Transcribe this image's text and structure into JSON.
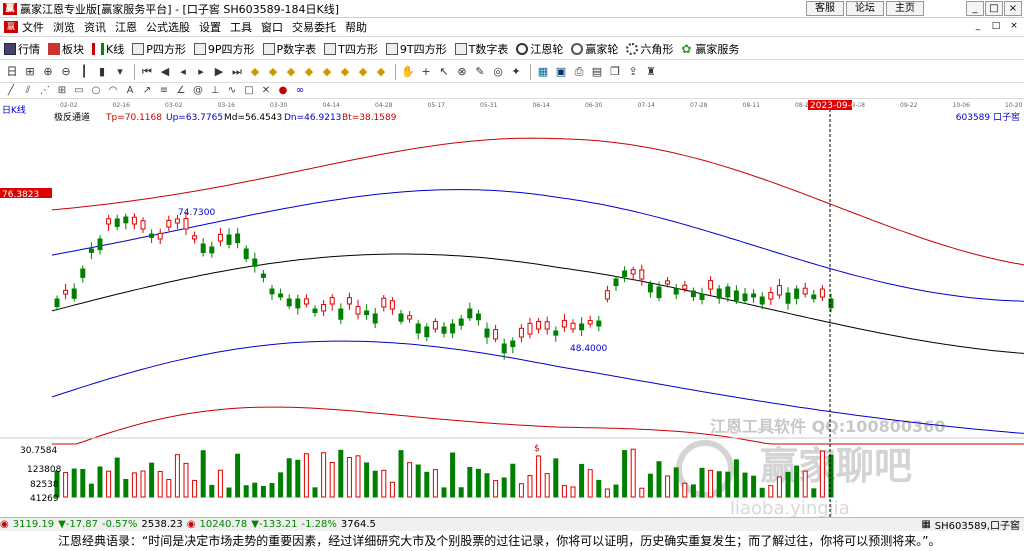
{
  "window": {
    "title": "赢家江恩专业版[赢家服务平台] - [口子窖  SH603589-184日K线]",
    "links": [
      "客服",
      "论坛",
      "主页"
    ],
    "controls": [
      "_",
      "□",
      "×"
    ]
  },
  "menu": {
    "items": [
      "文件",
      "浏览",
      "资讯",
      "江恩",
      "公式选股",
      "设置",
      "工具",
      "窗口",
      "交易委托",
      "帮助"
    ],
    "child_controls": [
      "_",
      "□",
      "×"
    ]
  },
  "toolbar1": {
    "items": [
      {
        "label": "行情",
        "icon": "grid-icon"
      },
      {
        "label": "板块",
        "icon": "blocks-icon"
      },
      {
        "label": "K线",
        "icon": "candlestick-icon"
      },
      {
        "label": "P四方形",
        "icon": "p-square-icon"
      },
      {
        "label": "9P四方形",
        "icon": "9p-square-icon"
      },
      {
        "label": "P数字表",
        "icon": "p-table-icon"
      },
      {
        "label": "T四方形",
        "icon": "t-square-icon"
      },
      {
        "label": "9T四方形",
        "icon": "9t-square-icon"
      },
      {
        "label": "T数字表",
        "icon": "t-table-icon"
      },
      {
        "label": "江恩轮",
        "icon": "gann-wheel-icon"
      },
      {
        "label": "赢家轮",
        "icon": "winner-wheel-icon"
      },
      {
        "label": "六角形",
        "icon": "hexagon-icon"
      },
      {
        "label": "赢家服务",
        "icon": "service-icon"
      }
    ]
  },
  "chart_info": {
    "period_label": "日K线",
    "indicator_name": "极反通道",
    "tp": "Tp=70.1168",
    "up": "Up=63.7765",
    "md": "Md=56.4543",
    "dn": "Dn=46.9213",
    "bt": "Bt=38.1589",
    "stock": "603589  口子窖",
    "price_marker": "76.3823",
    "cursor_date": "2023-09-05",
    "high_label": "74.7300",
    "low_label": "48.4000",
    "vol_max": "30.7584",
    "vol_labels": [
      "123808",
      "82538",
      "41269"
    ],
    "watermark1": "江恩工具软件  QQ:100800360",
    "watermark2": "赢家聊吧",
    "watermark3": "liaoba.yingjia"
  },
  "date_axis": [
    "02-02",
    "02-16",
    "03-02",
    "03-16",
    "03-30",
    "04-14",
    "04-28",
    "05-17",
    "05-31",
    "06-14",
    "06-30",
    "07-14",
    "07-28",
    "08-11",
    "08-25",
    "09-08",
    "09-22",
    "10-06",
    "10-20"
  ],
  "status": {
    "sh_index": "3119.19",
    "sh_change": "▼-17.87",
    "sh_pct": "-0.57%",
    "sh_amount": "2538.23",
    "sz_index": "10240.78",
    "sz_change": "▼-133.21",
    "sz_pct": "-1.28%",
    "sz_amount": "3764.5",
    "stock_code": "SH603589,口子窖"
  },
  "quote": "江恩经典语录：“时间是决定市场走势的重要因素，经过详细研究大市及个别股票的过往记录，你将可以证明，历史确实重复发生；而了解过往，你将可以预测将来。”。",
  "colors": {
    "up_candle": "#e00000",
    "down_candle": "#008000",
    "tp_line": "#cc0000",
    "up_line": "#0000cc",
    "md_line": "#000000"
  }
}
